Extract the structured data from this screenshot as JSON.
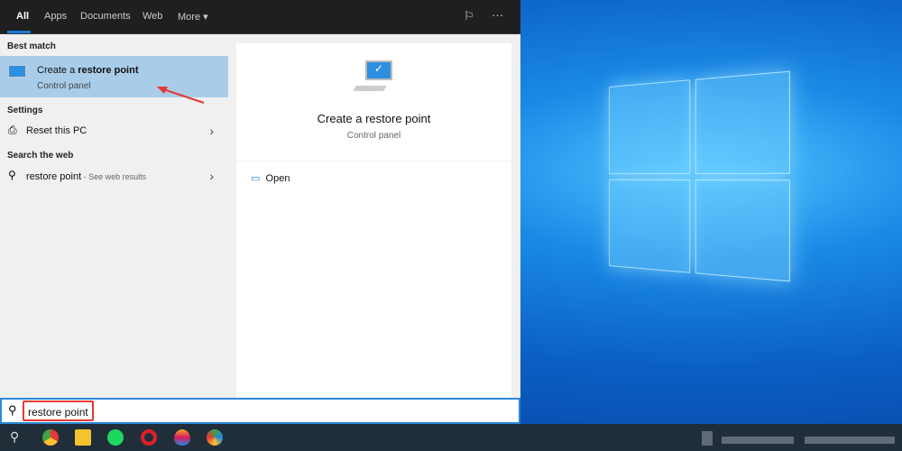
{
  "tabs": [
    {
      "label": "All"
    },
    {
      "label": "Apps"
    },
    {
      "label": "Documents"
    },
    {
      "label": "Web"
    },
    {
      "label": "More"
    }
  ],
  "sections": {
    "best_match": "Best match",
    "settings": "Settings",
    "web": "Search the web"
  },
  "best": {
    "title_prefix": "Create a ",
    "title_bold": "restore point",
    "subtitle": "Control panel"
  },
  "settings_item": "Reset this PC",
  "web_item": {
    "query": "restore point",
    "suffix": " - See web results"
  },
  "preview": {
    "title": "Create a restore point",
    "subtitle": "Control panel",
    "open_label": "Open"
  },
  "search": {
    "value": "restore point"
  },
  "colors": {
    "accent": "#2b88d8",
    "highlight": "#a9cde9",
    "annotation": "#e53935"
  }
}
